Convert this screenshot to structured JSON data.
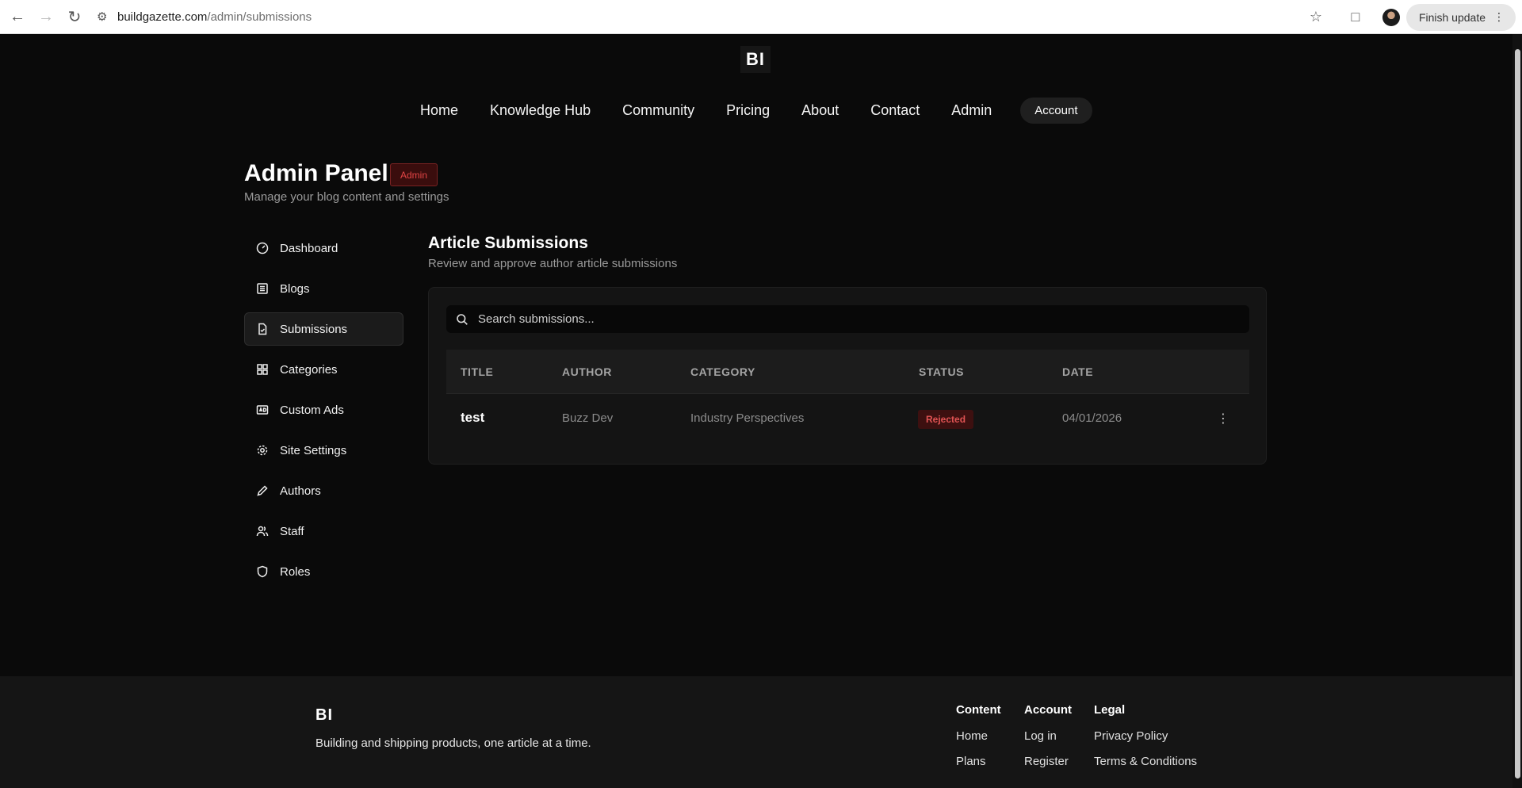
{
  "browser": {
    "url_host": "buildgazette.com",
    "url_path": "/admin/submissions",
    "finish_update": "Finish update"
  },
  "site": {
    "logo": "BI",
    "nav": [
      "Home",
      "Knowledge Hub",
      "Community",
      "Pricing",
      "About",
      "Contact",
      "Admin"
    ],
    "account": "Account"
  },
  "admin": {
    "title": "Admin Panel",
    "badge": "Admin",
    "subtitle": "Manage your blog content and settings"
  },
  "sidebar": {
    "items": [
      {
        "label": "Dashboard",
        "icon": "dashboard-icon"
      },
      {
        "label": "Blogs",
        "icon": "list-icon"
      },
      {
        "label": "Submissions",
        "icon": "file-check-icon",
        "active": true
      },
      {
        "label": "Categories",
        "icon": "grid-icon"
      },
      {
        "label": "Custom Ads",
        "icon": "ad-icon"
      },
      {
        "label": "Site Settings",
        "icon": "gear-icon"
      },
      {
        "label": "Authors",
        "icon": "pencil-icon"
      },
      {
        "label": "Staff",
        "icon": "users-icon"
      },
      {
        "label": "Roles",
        "icon": "shield-icon"
      }
    ]
  },
  "content": {
    "title": "Article Submissions",
    "subtitle": "Review and approve author article submissions",
    "search_placeholder": "Search submissions...",
    "columns": [
      "TITLE",
      "AUTHOR",
      "CATEGORY",
      "STATUS",
      "DATE"
    ],
    "rows": [
      {
        "title": "test",
        "author": "Buzz Dev",
        "category": "Industry Perspectives",
        "status": "Rejected",
        "date": "04/01/2026"
      }
    ]
  },
  "footer": {
    "logo": "BI",
    "tagline": "Building and shipping products, one article at a time.",
    "columns": [
      {
        "heading": "Content",
        "links": [
          "Home",
          "Plans"
        ]
      },
      {
        "heading": "Account",
        "links": [
          "Log in",
          "Register"
        ]
      },
      {
        "heading": "Legal",
        "links": [
          "Privacy Policy",
          "Terms & Conditions"
        ]
      }
    ]
  },
  "colors": {
    "background": "#0a0a0a",
    "card": "#141414",
    "rejected": "#e05353",
    "admin_badge": "#e24545"
  }
}
